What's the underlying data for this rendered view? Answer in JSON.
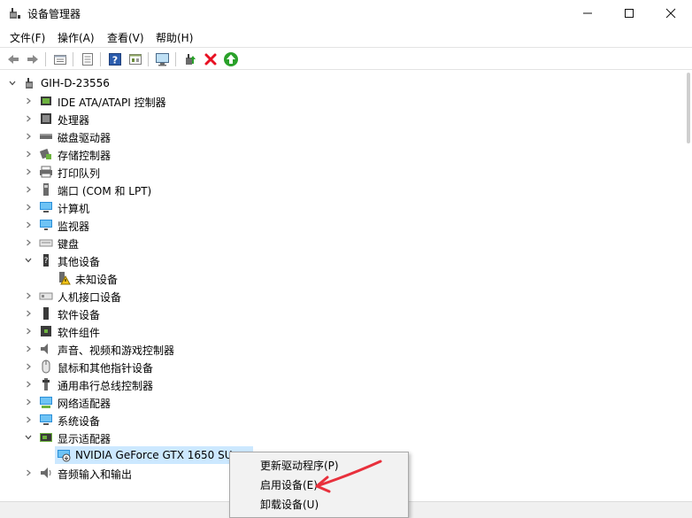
{
  "window": {
    "title": "设备管理器",
    "minimize": "—",
    "maximize": "☐",
    "close": "✕"
  },
  "menu": [
    "文件(F)",
    "操作(A)",
    "查看(V)",
    "帮助(H)"
  ],
  "tree": {
    "root": "GIH-D-23556",
    "nodes": [
      {
        "label": "IDE ATA/ATAPI 控制器",
        "icon": "ide-controller-icon",
        "expanded": false
      },
      {
        "label": "处理器",
        "icon": "processor-icon",
        "expanded": false
      },
      {
        "label": "磁盘驱动器",
        "icon": "disk-drive-icon",
        "expanded": false
      },
      {
        "label": "存储控制器",
        "icon": "storage-controller-icon",
        "expanded": false
      },
      {
        "label": "打印队列",
        "icon": "printer-icon",
        "expanded": false
      },
      {
        "label": "端口 (COM 和 LPT)",
        "icon": "port-icon",
        "expanded": false
      },
      {
        "label": "计算机",
        "icon": "computer-icon",
        "expanded": false
      },
      {
        "label": "监视器",
        "icon": "monitor-icon",
        "expanded": false
      },
      {
        "label": "键盘",
        "icon": "keyboard-icon",
        "expanded": false
      },
      {
        "label": "其他设备",
        "icon": "other-devices-icon",
        "expanded": true
      },
      {
        "label": "未知设备",
        "icon": "unknown-device-warning-icon",
        "child": true
      },
      {
        "label": "人机接口设备",
        "icon": "hid-icon",
        "expanded": false
      },
      {
        "label": "软件设备",
        "icon": "software-device-icon",
        "expanded": false
      },
      {
        "label": "软件组件",
        "icon": "software-component-icon",
        "expanded": false
      },
      {
        "label": "声音、视频和游戏控制器",
        "icon": "sound-icon",
        "expanded": false
      },
      {
        "label": "鼠标和其他指针设备",
        "icon": "mouse-icon",
        "expanded": false
      },
      {
        "label": "通用串行总线控制器",
        "icon": "usb-icon",
        "expanded": false
      },
      {
        "label": "网络适配器",
        "icon": "network-adapter-icon",
        "expanded": false
      },
      {
        "label": "系统设备",
        "icon": "system-device-icon",
        "expanded": false
      },
      {
        "label": "显示适配器",
        "icon": "display-adapter-icon",
        "expanded": true
      },
      {
        "label": "NVIDIA GeForce GTX 1650 SU",
        "icon": "gpu-disabled-icon",
        "child": true,
        "selected": true
      },
      {
        "label": "音频输入和输出",
        "icon": "audio-io-icon",
        "expanded": false
      }
    ]
  },
  "context_menu": {
    "items": [
      "更新驱动程序(P)",
      "启用设备(E)",
      "卸载设备(U)"
    ]
  },
  "colors": {
    "selection": "#cce8ff",
    "annotation": "#e8303c",
    "disable_x": "#e81123",
    "enable_green": "#2aa12a",
    "help_blue": "#2b5cad"
  }
}
